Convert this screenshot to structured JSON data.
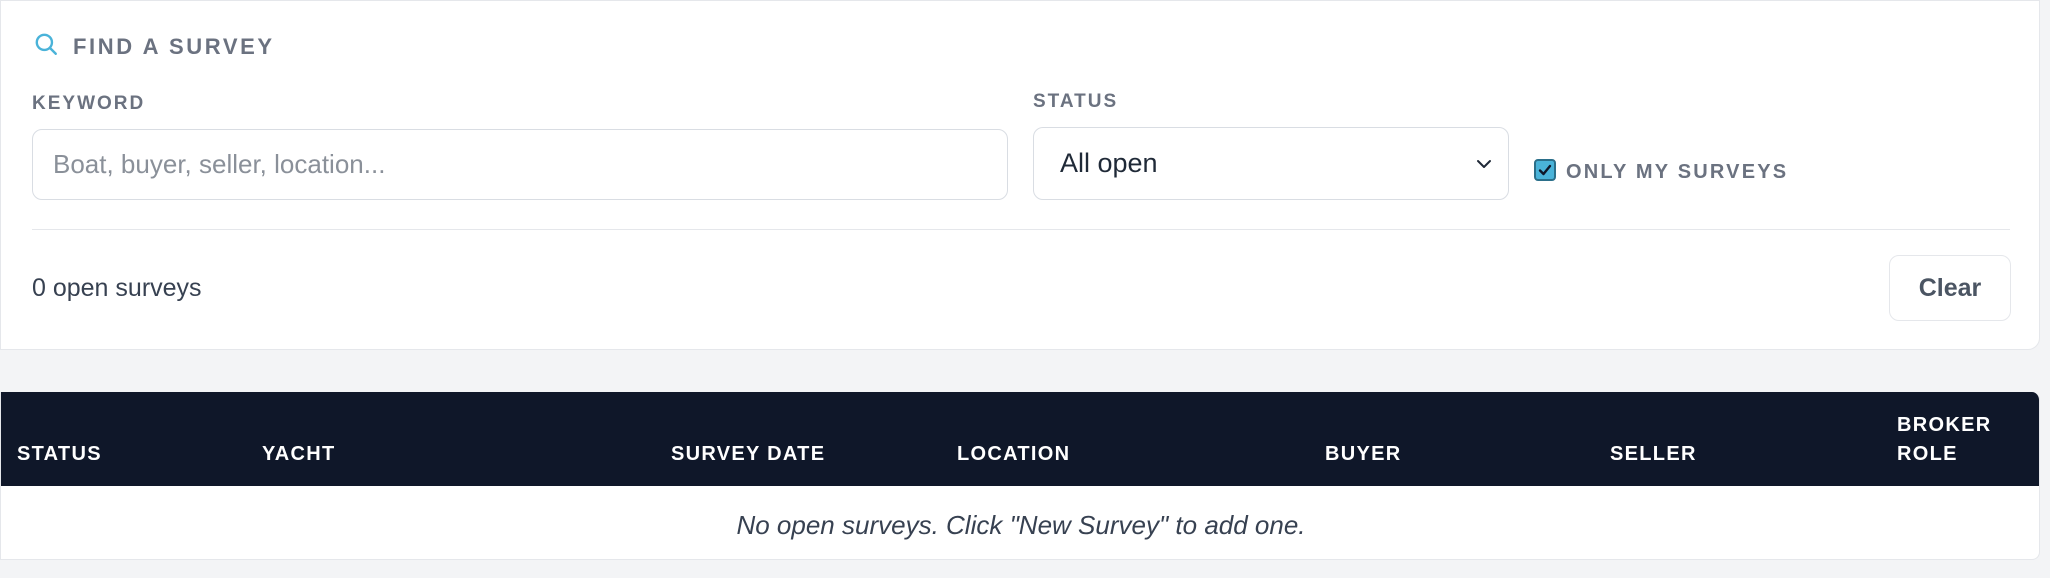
{
  "filters": {
    "title": "FIND A SURVEY",
    "keyword": {
      "label": "KEYWORD",
      "placeholder": "Boat, buyer, seller, location...",
      "value": ""
    },
    "status": {
      "label": "STATUS",
      "selected": "All open"
    },
    "only_mine": {
      "label": "ONLY MY SURVEYS",
      "checked": true
    },
    "result_count": "0 open surveys",
    "clear_label": "Clear"
  },
  "table": {
    "columns": [
      {
        "label": "STATUS"
      },
      {
        "label": "YACHT"
      },
      {
        "label": "SURVEY DATE"
      },
      {
        "label": "LOCATION"
      },
      {
        "label": "BUYER"
      },
      {
        "label": "SELLER"
      },
      {
        "label": "BROKER ROLE"
      }
    ],
    "rows": [],
    "empty_message": "No open surveys. Click \"New Survey\" to add one."
  },
  "colors": {
    "accent": "#4ab3d9",
    "table_header_bg": "#0f1729",
    "page_bg": "#f3f4f6"
  },
  "icons": {
    "title_icon": "search-icon",
    "select_icon": "chevron-down-icon",
    "checkbox_icon": "check-icon"
  }
}
